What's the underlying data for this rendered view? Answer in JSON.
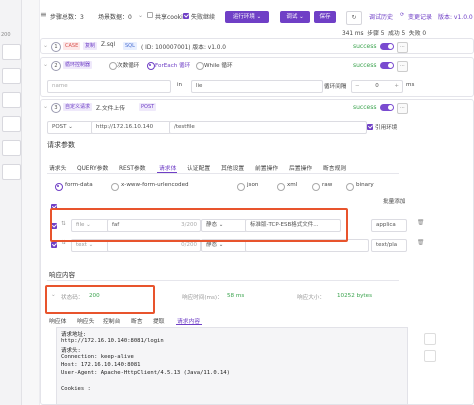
{
  "left_rail": {
    "number": "200"
  },
  "toolbar": {
    "steps_total_label": "步骤总数：3",
    "scene_data_label": "场景数据：0",
    "share_cookie_label": "共享cookie",
    "fail_continue_label": "失败继续",
    "run_env_button": "运行环境",
    "debug_button": "调试",
    "save_button": "保存",
    "debug_history_link": "调试历史",
    "change_record_link": "变更记录",
    "version_label": "版本: v1.0.0"
  },
  "stats": {
    "time": "341 ms",
    "total": "步骤 5",
    "success": "成功 5",
    "fail": "失败 0"
  },
  "steps": [
    {
      "index": "1",
      "tag_type": "CASE",
      "tag_copy": "复制",
      "name": "Z.sql",
      "sql_tag": "SQL",
      "id_text": "( ID: 100007001)  版本: v1.0.0",
      "status": "success"
    },
    {
      "index": "2",
      "tag_type": "循环控制器",
      "loop_options": [
        "次数循环",
        "ForEach 循环",
        "While 循环"
      ],
      "selected_loop": "ForEach 循环",
      "status": "success",
      "loop_var_placeholder": "name",
      "in_text": "in",
      "loop_source": "lie",
      "interval_label": "循环间隔",
      "interval_value": "0",
      "interval_unit": "ms"
    },
    {
      "index": "3",
      "tag_type": "自定义请求",
      "name": "Z.文件上传",
      "method_tag": "POST",
      "status": "success"
    }
  ],
  "request": {
    "method": "POST",
    "host": "http://172.16.10.140",
    "path": "/testfile",
    "ref_env_label": "引用环境",
    "params_title": "请求参数",
    "tabs": [
      "请求头",
      "QUERY参数",
      "REST参数",
      "请求体",
      "认证配置",
      "其他设置",
      "前置操作",
      "后置操作",
      "断言规则"
    ],
    "active_tab": "请求体",
    "body_types": [
      "form-data",
      "x-www-form-urlencoded",
      "json",
      "xml",
      "raw",
      "binary"
    ],
    "selected_body_type": "form-data",
    "batch_edit_label": "批量添加",
    "rows": [
      {
        "type": "file",
        "key": "faf",
        "count": "3/200",
        "mode": "静态",
        "value": "标准版-TCP-ESB格式文件...",
        "content_type": "applica"
      },
      {
        "type": "text",
        "key": "",
        "count": "0/200",
        "mode": "静态",
        "value": "",
        "content_type": "text/pla"
      }
    ]
  },
  "response": {
    "section_title": "响应内容",
    "status_label": "状态码：",
    "status_code": "200",
    "time_label": "响应时间(ms)：",
    "time_value": "58 ms",
    "size_label": "响应大小：",
    "size_value": "10252 bytes",
    "tabs": [
      "响应体",
      "响应头",
      "控制台",
      "断言",
      "提取",
      "请求内容"
    ],
    "active_tab": "请求内容",
    "console_lines": [
      "请求地址:",
      "http://172.16.10.140:8081/login",
      "请求头:",
      "Connection: keep-alive",
      "Host: 172.16.10.140:8081",
      "User-Agent: Apache-HttpClient/4.5.13 (Java/11.0.14)",
      "",
      "Cookies :"
    ]
  },
  "colors": {
    "accent": "#6f3fc6",
    "success": "#3aa34d",
    "highlight": "#e8542d"
  }
}
